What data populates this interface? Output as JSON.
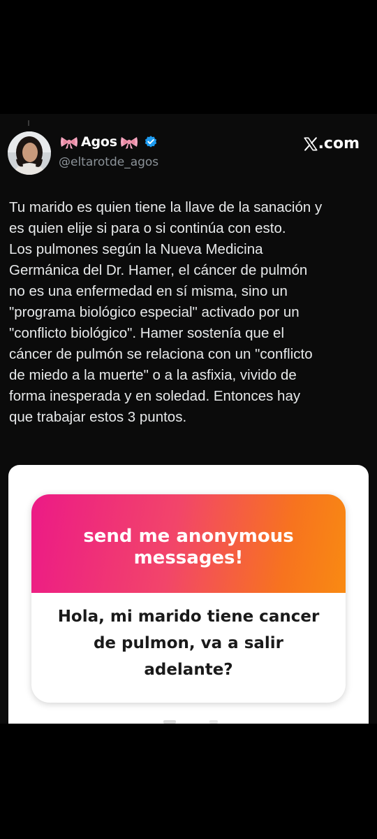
{
  "post": {
    "author": {
      "name": "Agos",
      "handle": "@eltarotde_agos",
      "verified": true,
      "bow_icon": "ribbon-bow-emoji",
      "verified_icon": "verified-badge-icon"
    },
    "site": {
      "logo_icon": "x-logo-icon",
      "label": ".com"
    },
    "text": "Tu marido es quien tiene la llave de la sanación y\nes quien elije si para o si continúa con esto.\nLos pulmones según la Nueva Medicina\nGermánica del Dr. Hamer, el cáncer de pulmón\nno es una enfermedad en sí misma, sino un\n\"programa biológico especial\" activado por un\n\"conflicto biológico\". Hamer sostenía que el\ncáncer de pulmón se relaciona con un \"conflicto\nde miedo a la muerte\" o a la asfixia, vivido de\nforma inesperada y en soledad. Entonces hay\nque trabajar estos 3 puntos."
  },
  "question_card": {
    "header": "send me anonymous messages!",
    "question": "Hola, mi marido tiene cancer de pulmon, va a salir adelante?"
  },
  "colors": {
    "background": "#000000",
    "post_background": "#0b0b0b",
    "gradient_start": "#ec1a86",
    "gradient_end": "#f98a12",
    "verified_blue": "#1d9bf0",
    "handle_gray": "#8b9298"
  }
}
